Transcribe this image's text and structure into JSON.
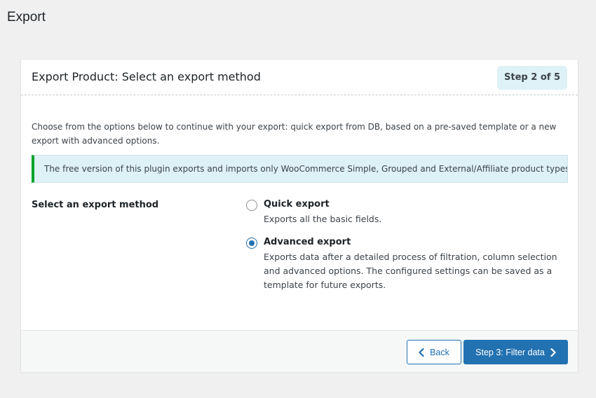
{
  "page": {
    "title": "Export"
  },
  "card": {
    "title": "Export Product: Select an export method",
    "step_badge": "Step 2 of 5",
    "intro": "Choose from the options below to continue with your export: quick export from DB, based on a pre-saved template or a new export with advanced options.",
    "notice": "The free version of this plugin exports and imports only WooCommerce Simple, Grouped and External/Affiliate product types."
  },
  "method": {
    "label": "Select an export method",
    "options": [
      {
        "title": "Quick export",
        "description": "Exports all the basic fields.",
        "selected": false
      },
      {
        "title": "Advanced export",
        "description": "Exports data after a detailed process of filtration, column selection and advanced options. The configured settings can be saved as a template for future exports.",
        "selected": true
      }
    ]
  },
  "footer": {
    "back_label": "Back",
    "next_label": "Step 3: Filter data"
  },
  "colors": {
    "primary": "#2271b1",
    "notice_bg": "#def1f7",
    "notice_border": "#00a32a",
    "background": "#f0f0f1"
  },
  "icons": {
    "back": "chevron-left-icon",
    "next": "chevron-right-icon"
  }
}
